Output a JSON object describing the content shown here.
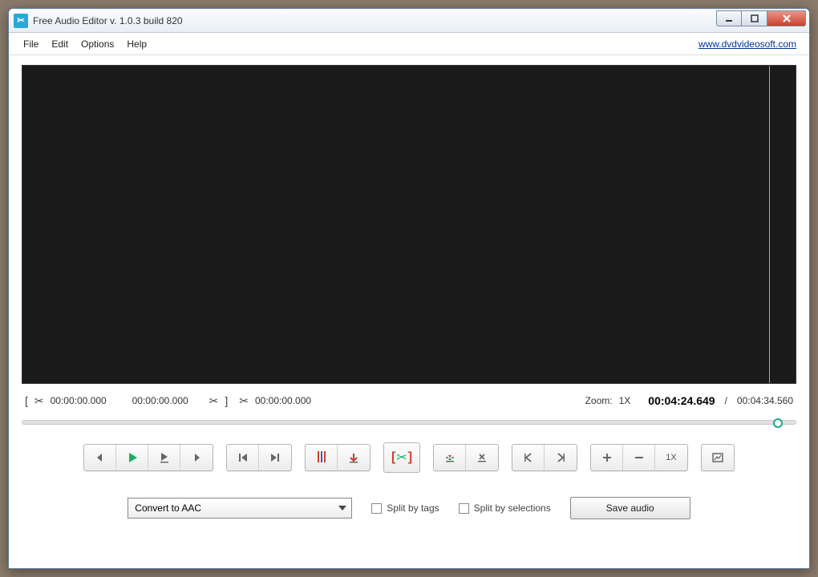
{
  "window": {
    "title": "Free Audio Editor v. 1.0.3 build 820"
  },
  "menu": {
    "file": "File",
    "edit": "Edit",
    "options": "Options",
    "help": "Help",
    "link": "www.dvdvideosoft.com"
  },
  "times": {
    "sel_start": "00:00:00.000",
    "sel_end": "00:00:00.000",
    "cursor": "00:00:00.000",
    "zoom_label": "Zoom:",
    "zoom_value": "1X",
    "position": "00:04:24.649",
    "divider": "/",
    "duration": "00:04:34.560"
  },
  "toolbar": {
    "zoom_display": "1X"
  },
  "bottom": {
    "convert_selected": "Convert to AAC",
    "split_tags": "Split by tags",
    "split_selections": "Split by selections",
    "save": "Save audio"
  }
}
